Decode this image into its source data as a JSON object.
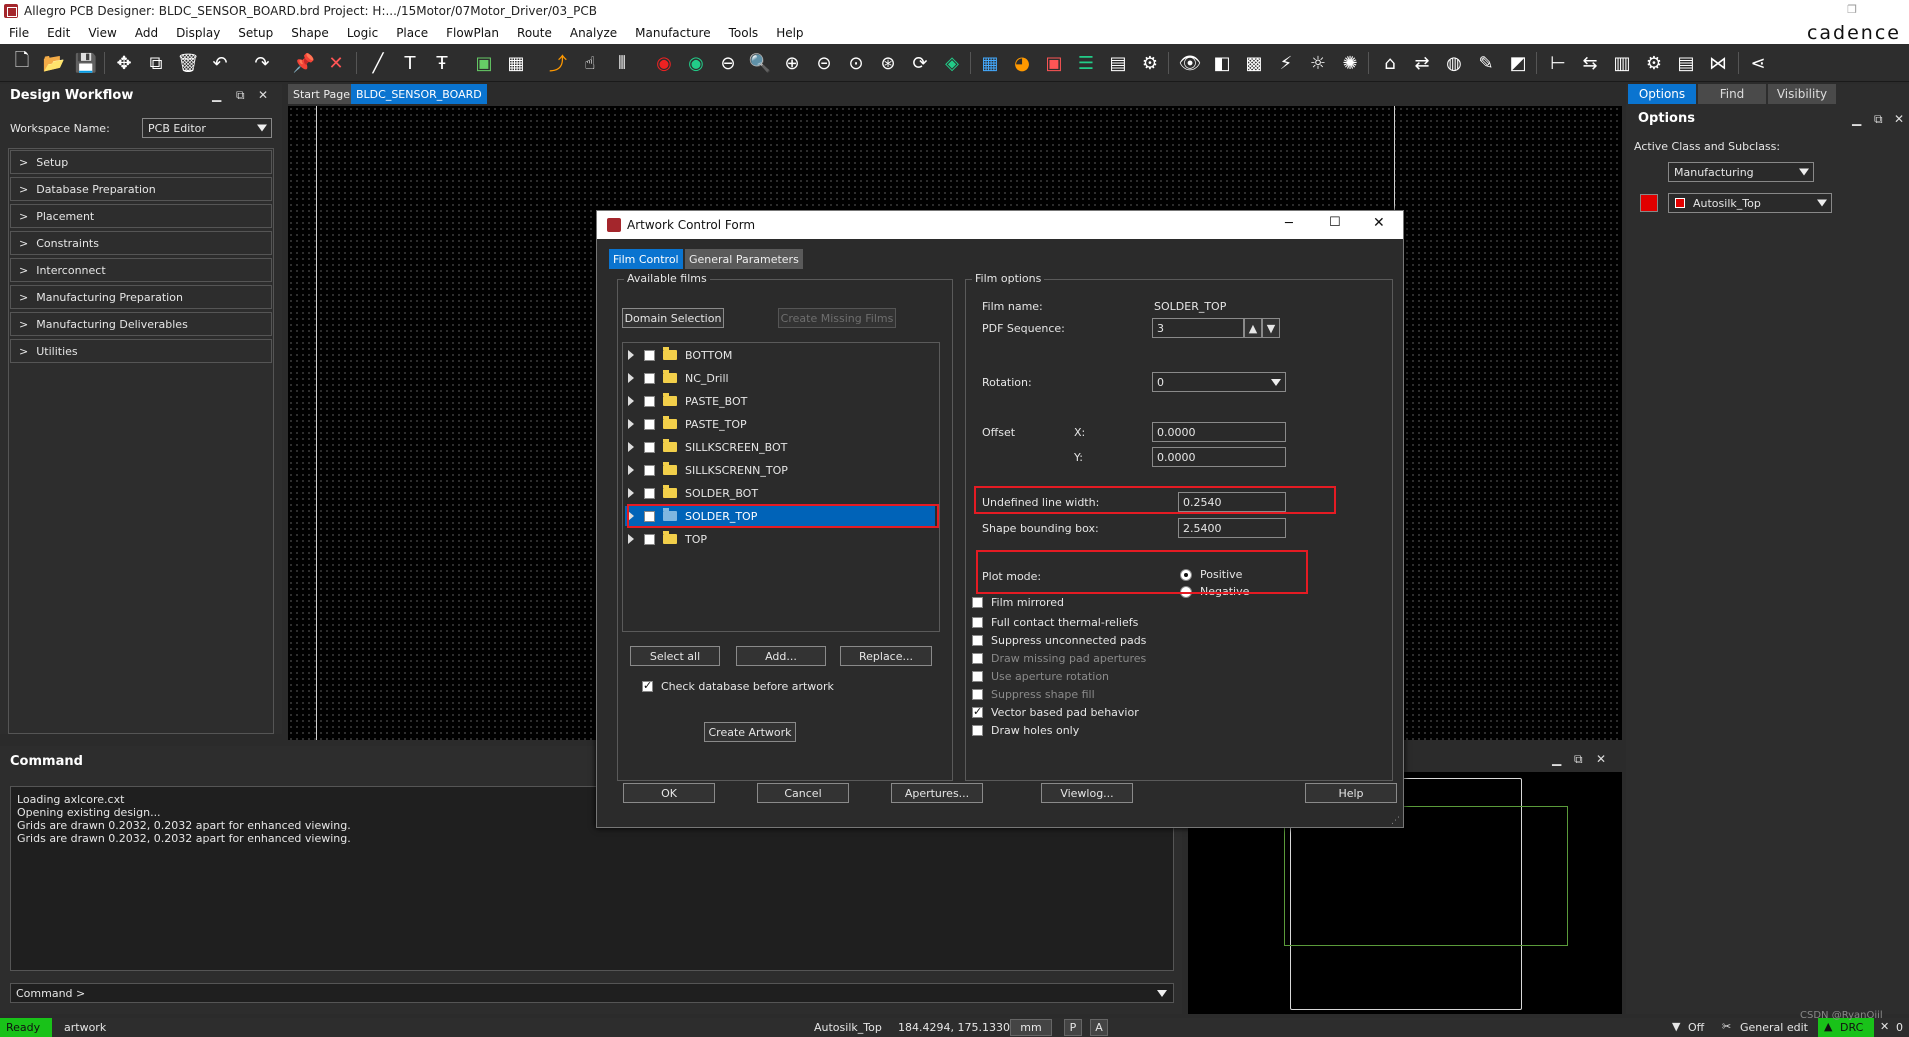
{
  "window": {
    "title": "Allegro PCB Designer: BLDC_SENSOR_BOARD.brd  Project: H:.../15Motor/07Motor_Driver/03_PCB",
    "brand": "cadence"
  },
  "menu": [
    "File",
    "Edit",
    "View",
    "Add",
    "Display",
    "Setup",
    "Shape",
    "Logic",
    "Place",
    "FlowPlan",
    "Route",
    "Analyze",
    "Manufacture",
    "Tools",
    "Help"
  ],
  "left_panel": {
    "title": "Design Workflow",
    "workspace_label": "Workspace Name:",
    "workspace_value": "PCB Editor",
    "items": [
      "Setup",
      "Database Preparation",
      "Placement",
      "Constraints",
      "Interconnect",
      "Manufacturing Preparation",
      "Manufacturing Deliverables",
      "Utilities"
    ]
  },
  "doc_tabs": [
    "Start Page",
    "BLDC_SENSOR_BOARD"
  ],
  "right_panel": {
    "tabs": [
      "Options",
      "Find",
      "Visibility"
    ],
    "title": "Options",
    "class_label": "Active Class and Subclass:",
    "class_value": "Manufacturing",
    "subclass_value": "Autosilk_Top",
    "color_swatch": "#e10000"
  },
  "command": {
    "title": "Command",
    "log": [
      "Loading axlcore.cxt",
      "Opening existing design...",
      "Grids are drawn 0.2032, 0.2032 apart for enhanced viewing.",
      "Grids are drawn 0.2032, 0.2032 apart for enhanced viewing."
    ],
    "prompt": "Command >"
  },
  "status": {
    "ready": "Ready",
    "command": "artwork",
    "subclass": "Autosilk_Top",
    "coords": "184.4294, 175.1330",
    "units": "mm",
    "p": "P",
    "a": "A",
    "filter": "Off",
    "mode": "General edit",
    "drc": "DRC",
    "drc_count": "0",
    "watermark": "CSDN @RyanOiil"
  },
  "dialog": {
    "title": "Artwork Control Form",
    "tabs": [
      "Film Control",
      "General Parameters"
    ],
    "available_films_label": "Available films",
    "domain_selection": "Domain Selection",
    "create_missing_films": "Create Missing Films",
    "films": [
      "BOTTOM",
      "NC_Drill",
      "PASTE_BOT",
      "PASTE_TOP",
      "SILLKSCREEN_BOT",
      "SILLKSCRENN_TOP",
      "SOLDER_BOT",
      "SOLDER_TOP",
      "TOP"
    ],
    "selected_film": "SOLDER_TOP",
    "select_all": "Select all",
    "add": "Add...",
    "replace": "Replace...",
    "check_db": "Check database before artwork",
    "create_artwork": "Create Artwork",
    "film_options": {
      "label": "Film options",
      "film_name_label": "Film name:",
      "film_name": "SOLDER_TOP",
      "pdf_seq_label": "PDF Sequence:",
      "pdf_seq": "3",
      "rotation_label": "Rotation:",
      "rotation": "0",
      "offset_label": "Offset",
      "x_label": "X:",
      "x": "0.0000",
      "y_label": "Y:",
      "y": "0.0000",
      "undef_width_label": "Undefined line width:",
      "undef_width": "0.2540",
      "shape_bbox_label": "Shape bounding box:",
      "shape_bbox": "2.5400",
      "plot_mode_label": "Plot mode:",
      "positive": "Positive",
      "negative": "Negative",
      "checks": [
        {
          "label": "Film mirrored",
          "checked": false,
          "dim": false
        },
        {
          "label": "Full contact thermal-reliefs",
          "checked": false,
          "dim": false
        },
        {
          "label": "Suppress unconnected pads",
          "checked": false,
          "dim": false
        },
        {
          "label": "Draw missing pad apertures",
          "checked": false,
          "dim": true
        },
        {
          "label": "Use aperture rotation",
          "checked": false,
          "dim": true
        },
        {
          "label": "Suppress shape fill",
          "checked": false,
          "dim": true
        },
        {
          "label": "Vector based pad behavior",
          "checked": true,
          "dim": false
        },
        {
          "label": "Draw holes only",
          "checked": false,
          "dim": false
        }
      ]
    },
    "buttons": [
      "OK",
      "Cancel",
      "Apertures...",
      "Viewlog...",
      "Help"
    ]
  },
  "colors": {
    "accent_blue": "#0063b8",
    "highlight_red": "#e51b23",
    "status_green": "#19c219"
  }
}
